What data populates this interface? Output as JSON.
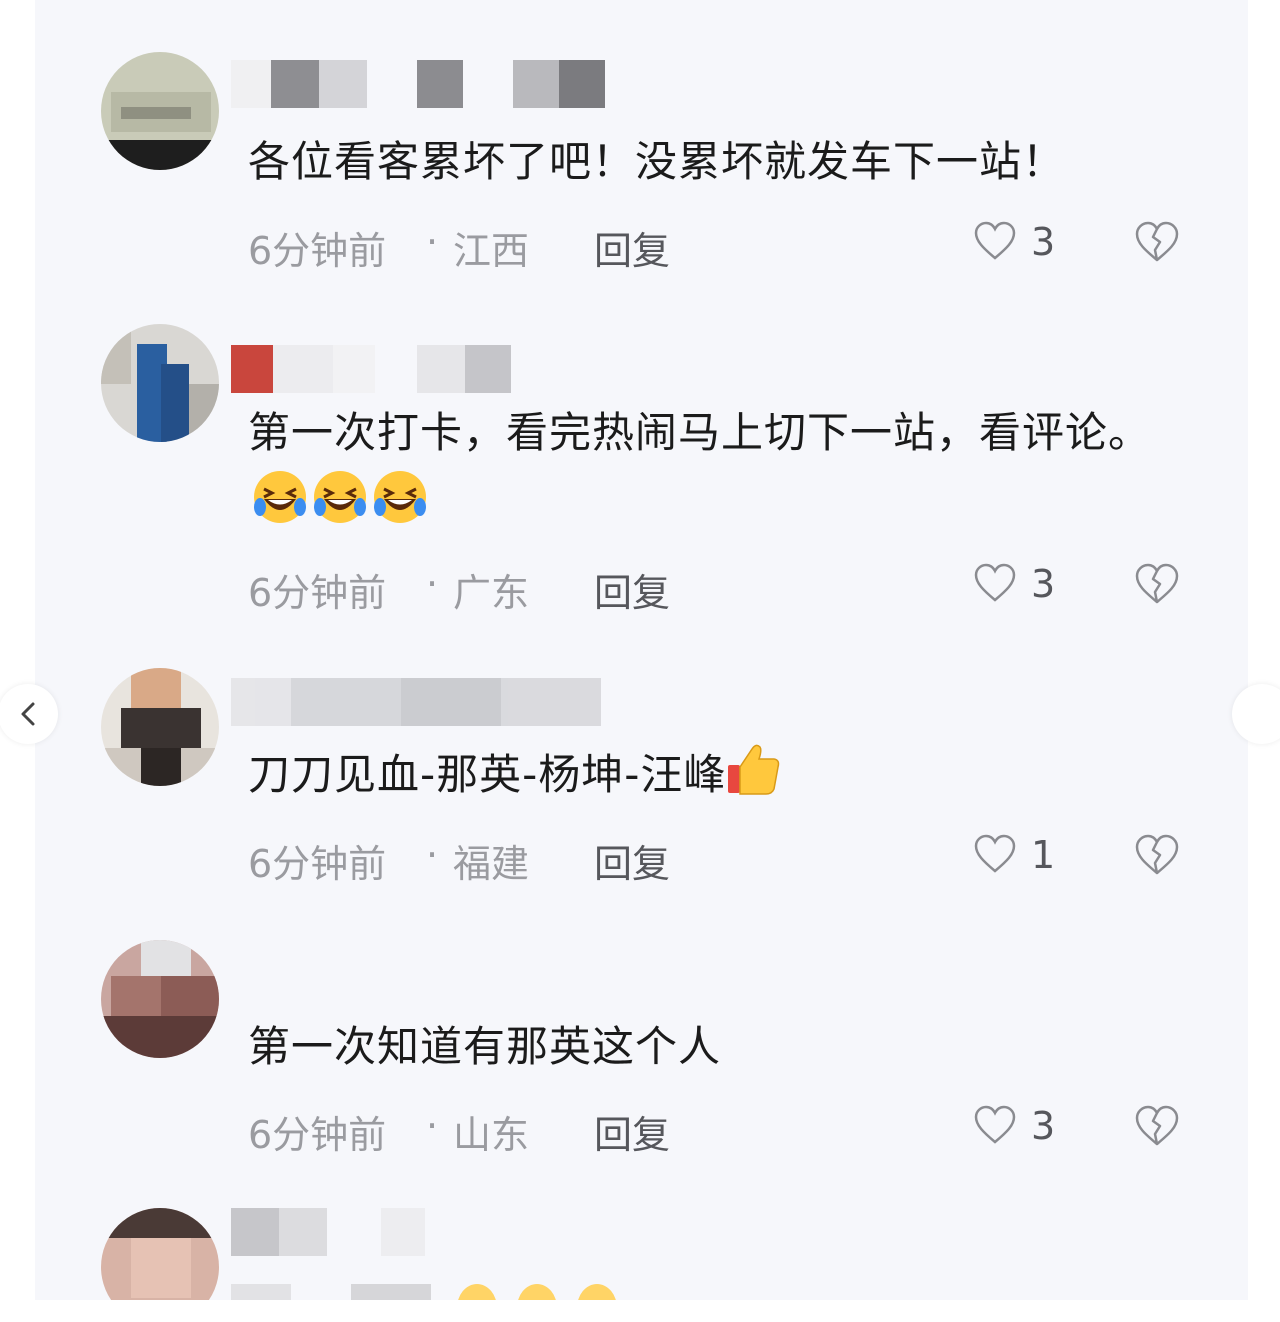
{
  "comments": [
    {
      "text": "各位看客累坏了吧！没累坏就发车下一站！",
      "time": "6分钟前",
      "separator": "·",
      "region": "江西",
      "reply": "回复",
      "likes": "3"
    },
    {
      "text": "第一次打卡，看完热闹马上切下一站，看评论。",
      "emoji": [
        "laughing-crying-emoji",
        "laughing-crying-emoji",
        "laughing-crying-emoji"
      ],
      "time": "6分钟前",
      "separator": "·",
      "region": "广东",
      "reply": "回复",
      "likes": "3"
    },
    {
      "text": "刀刀见血-那英-杨坤-汪峰",
      "emoji": [
        "thumbs-up-emoji"
      ],
      "time": "6分钟前",
      "separator": "·",
      "region": "福建",
      "reply": "回复",
      "likes": "1"
    },
    {
      "text": "第一次知道有那英这个人",
      "time": "6分钟前",
      "separator": "·",
      "region": "山东",
      "reply": "回复",
      "likes": "3"
    }
  ],
  "icons": {
    "like": "heart-outline-icon",
    "dislike": "broken-heart-icon",
    "nav_left": "chevron-left-icon"
  },
  "colors": {
    "background": "#f6f7fb",
    "text": "#1b1b1b",
    "meta": "#9a9ba0",
    "action": "#56575c"
  }
}
